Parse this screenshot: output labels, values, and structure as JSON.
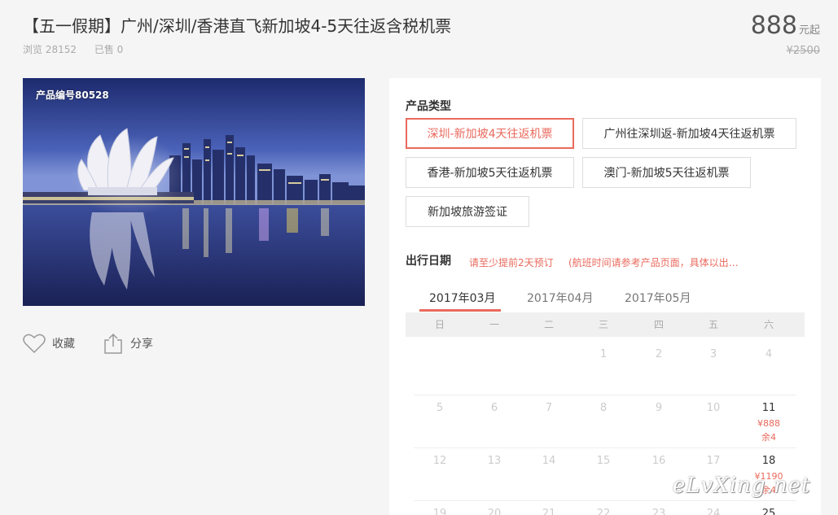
{
  "product": {
    "title": "【五一假期】广州/深圳/香港直飞新加坡4-5天往返含税机票",
    "views": "浏览 28152",
    "sold": "已售 0",
    "price": "888",
    "price_unit": "元起",
    "original_price": "¥2500",
    "code": "产品编号80528"
  },
  "actions": {
    "favorite": "收藏",
    "share": "分享"
  },
  "booking": {
    "type_label": "产品类型",
    "options": [
      "深圳-新加坡4天往返机票",
      "广州往深圳返-新加坡4天往返机票",
      "香港-新加坡5天往返机票",
      "澳门-新加坡5天往返机票",
      "新加坡旅游签证"
    ],
    "date_label": "出行日期",
    "hint_advance": "请至少提前2天预订",
    "hint_flight": "(航班时间请参考产品页面，具体以出…",
    "months": [
      "2017年03月",
      "2017年04月",
      "2017年05月"
    ],
    "weekdays": [
      "日",
      "一",
      "二",
      "三",
      "四",
      "五",
      "六"
    ],
    "days": {
      "d1": "1",
      "d2": "2",
      "d3": "3",
      "d4": "4",
      "d5": "5",
      "d6": "6",
      "d7": "7",
      "d8": "8",
      "d9": "9",
      "d10": "10",
      "d11": "11",
      "d12": "12",
      "d13": "13",
      "d14": "14",
      "d15": "15",
      "d16": "16",
      "d17": "17",
      "d18": "18",
      "d19": "19",
      "d20": "20",
      "d21": "21",
      "d22": "22",
      "d23": "23",
      "d24": "24",
      "d25": "25"
    },
    "d11_price": "¥888",
    "d11_stock": "余4",
    "d18_price": "¥1190",
    "d18_stock": "余4"
  },
  "watermark": "eLvXing.net",
  "colors": {
    "accent": "#e96a5d",
    "background": "#f5f5f5"
  }
}
